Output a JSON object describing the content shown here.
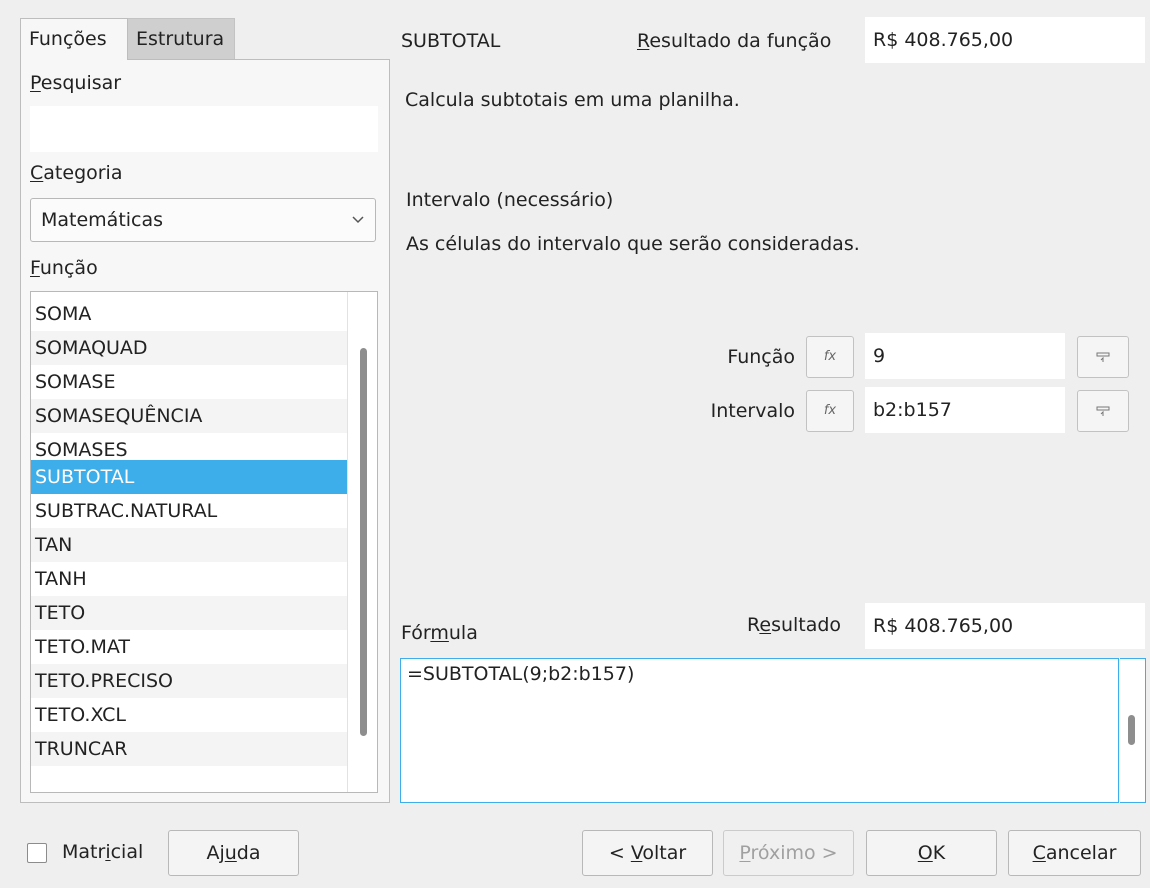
{
  "tabs": [
    {
      "label_pre": "Funções",
      "label_ul": "",
      "label_post": ""
    },
    {
      "label": "Estrutura"
    }
  ],
  "left": {
    "search_label_ul": "P",
    "search_label_rest": "esquisar",
    "search_value": "",
    "category_label_ul": "C",
    "category_label_rest": "ategoria",
    "category_value": "Matemáticas",
    "function_label_ul": "F",
    "function_label_rest": "unção",
    "functions": [
      "SOMA",
      "SOMAQUAD",
      "SOMASE",
      "SOMASEQUÊNCIA",
      "SOMASES",
      "SUBTOTAL",
      "SUBTRAC.NATURAL",
      "TAN",
      "TANH",
      "TETO",
      "TETO.MAT",
      "TETO.PRECISO",
      "TETO.XCL",
      "TRUNCAR"
    ],
    "selected_function": "SUBTOTAL"
  },
  "right": {
    "function_name": "SUBTOTAL",
    "result_label_ul": "R",
    "result_label_rest": "esultado da função",
    "result_value": "R$ 408.765,00",
    "description": "Calcula subtotais em uma planilha.",
    "arg_title": "Intervalo (necessário)",
    "arg_description": "As células do intervalo que serão consideradas.",
    "args": [
      {
        "label": "Função",
        "value": "9"
      },
      {
        "label": "Intervalo",
        "value": "b2:b157"
      }
    ],
    "fx_glyph": "fx",
    "formula_label_pre": "Fór",
    "formula_label_ul": "m",
    "formula_label_post": "ula",
    "result2_label_pre": "R",
    "result2_label_ul": "e",
    "result2_label_post": "sultado",
    "result2_value": "R$ 408.765,00",
    "formula_value": "=SUBTOTAL(9;b2:b157)"
  },
  "bottom": {
    "matricial_pre": "Matr",
    "matricial_ul": "i",
    "matricial_post": "cial",
    "matricial_checked": false,
    "help_pre": "Aj",
    "help_ul": "u",
    "help_post": "da",
    "back_pre": "< ",
    "back_ul": "V",
    "back_post": "oltar",
    "next_ul": "P",
    "next_post": "róximo >",
    "ok_ul": "O",
    "ok_post": "K",
    "cancel_ul": "C",
    "cancel_post": "ancelar"
  }
}
